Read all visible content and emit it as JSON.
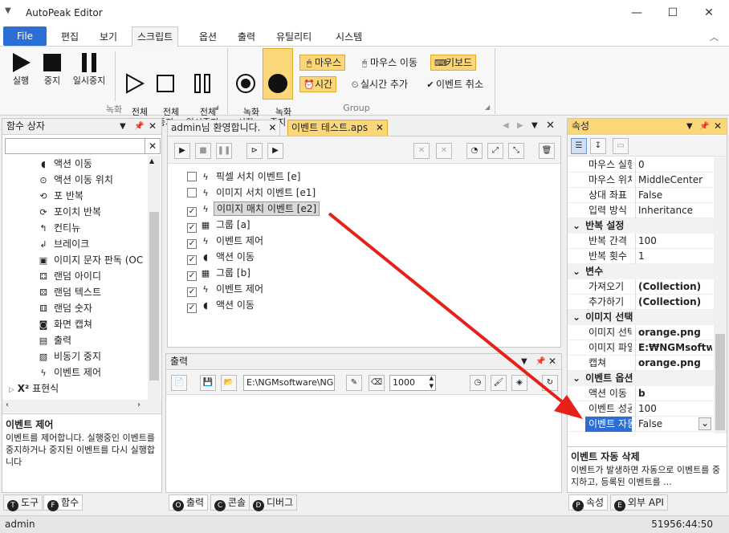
{
  "window": {
    "title": "AutoPeak Editor",
    "minimize": "—",
    "maximize": "☐",
    "close": "✕"
  },
  "menu": {
    "file": "File",
    "items": [
      "편집",
      "보기",
      "스크립트",
      "옵션",
      "출력",
      "유틸리티",
      "시스템"
    ],
    "active_index": 2
  },
  "ribbon": {
    "record_group": {
      "label": "녹화",
      "buttons": [
        "실행",
        "중지",
        "일시중지"
      ],
      "buttons2": [
        "전체\n실행",
        "전체\n중지",
        "전체\n일시중지"
      ]
    },
    "group2": {
      "label": "Group",
      "rec_start": "녹화\n시작",
      "rec_stop": "녹화\n중지",
      "mouse": "마우스",
      "mouse_move": "마우스 이동",
      "keyboard": "키보드",
      "time": "시간",
      "realtime_add": "실시간 추가",
      "event_cancel": "이벤트 취소"
    }
  },
  "func_panel": {
    "title": "함수 상자",
    "items": [
      {
        "icon": "◖",
        "label": "액션 이동"
      },
      {
        "icon": "⊙",
        "label": "액션 이동 위치"
      },
      {
        "icon": "⟲",
        "label": "포 반복"
      },
      {
        "icon": "⟳",
        "label": "포이치 반복"
      },
      {
        "icon": "↰",
        "label": "컨티뉴"
      },
      {
        "icon": "↲",
        "label": "브레이크"
      },
      {
        "icon": "▣",
        "label": "이미지 문자 판독 (OC"
      },
      {
        "icon": "⚃",
        "label": "랜덤 아이디"
      },
      {
        "icon": "⚄",
        "label": "랜덤 텍스트"
      },
      {
        "icon": "⚅",
        "label": "랜덤 숫자"
      },
      {
        "icon": "◙",
        "label": "화면 캡쳐"
      },
      {
        "icon": "▤",
        "label": "출력"
      },
      {
        "icon": "▧",
        "label": "비동기 중지"
      },
      {
        "icon": "ϟ",
        "label": "이벤트 제어"
      }
    ],
    "expr": "표현식",
    "desc_title": "이벤트 제어",
    "desc_text": "이벤트를 제어합니다. 실행중인 이벤트를 중지하거나 중지된 이벤트를 다시 실행합니다",
    "tabs": [
      "도구",
      "함수"
    ]
  },
  "doc_tabs": [
    "admin님 환영합니다.",
    "이벤트 테스트.aps"
  ],
  "script_tree": [
    {
      "checked": false,
      "icon": "ϟ",
      "label": "픽셀 서치 이벤트 [e]",
      "indent": 0
    },
    {
      "checked": false,
      "icon": "ϟ",
      "label": "이미지 서치 이벤트 [e1]",
      "indent": 0
    },
    {
      "checked": true,
      "icon": "ϟ",
      "label": "이미지 매치 이벤트 [e2]",
      "indent": 0,
      "selected": true
    },
    {
      "checked": true,
      "icon": "▦",
      "label": "그룹 [a]",
      "indent": 0
    },
    {
      "checked": true,
      "icon": "ϟ",
      "label": "이벤트 제어",
      "indent": 0
    },
    {
      "checked": true,
      "icon": "◖",
      "label": "액션 이동",
      "indent": 0
    },
    {
      "checked": true,
      "icon": "▦",
      "label": "그룹 [b]",
      "indent": 0
    },
    {
      "checked": true,
      "icon": "ϟ",
      "label": "이벤트 제어",
      "indent": 0
    },
    {
      "checked": true,
      "icon": "◖",
      "label": "액션 이동",
      "indent": 0
    }
  ],
  "output_panel": {
    "title": "출력",
    "path": "E:\\NGMsoftware\\NG",
    "number": "1000",
    "tabs": [
      "출력",
      "콘솔",
      "디버그"
    ]
  },
  "props": {
    "title": "속성",
    "rows": [
      {
        "type": "row",
        "name": "마우스 실행",
        "value": "0"
      },
      {
        "type": "row",
        "name": "마우스 위치",
        "value": "MiddleCenter"
      },
      {
        "type": "row",
        "name": "상대 좌표",
        "value": "False"
      },
      {
        "type": "row",
        "name": "입력 방식",
        "value": "Inheritance"
      },
      {
        "type": "cat",
        "name": "반복 설정"
      },
      {
        "type": "row",
        "name": "반복 간격",
        "value": "100"
      },
      {
        "type": "row",
        "name": "반복 횟수",
        "value": "1"
      },
      {
        "type": "cat",
        "name": "변수"
      },
      {
        "type": "row",
        "name": "가져오기",
        "value": "(Collection)",
        "bold": true
      },
      {
        "type": "row",
        "name": "추가하기",
        "value": "(Collection)",
        "bold": true
      },
      {
        "type": "cat",
        "name": "이미지 선택"
      },
      {
        "type": "row",
        "name": "이미지 선택",
        "value": "orange.png",
        "bold": true
      },
      {
        "type": "row",
        "name": "이미지 파일",
        "value": "E:₩NGMsoftware",
        "bold": true
      },
      {
        "type": "row",
        "name": "캡쳐",
        "value": "orange.png",
        "bold": true
      },
      {
        "type": "cat",
        "name": "이벤트 옵션"
      },
      {
        "type": "row",
        "name": "액션 이동",
        "value": "b",
        "bold": true
      },
      {
        "type": "row",
        "name": "이벤트 성공",
        "value": "100"
      },
      {
        "type": "row",
        "name": "이벤트 자동",
        "value": "False",
        "selected": true
      }
    ],
    "desc_title": "이벤트 자동 삭제",
    "desc_text": "이벤트가 발생하면 자동으로 이벤트를 중지하고, 등록된 이벤트를 ...",
    "tabs": [
      "속성",
      "외부 API"
    ]
  },
  "status": {
    "user": "admin",
    "time": "51956:44:50"
  },
  "colors": {
    "accent": "#2b6fd6",
    "highlight": "#fbd77a",
    "arrow": "#e8201a"
  }
}
